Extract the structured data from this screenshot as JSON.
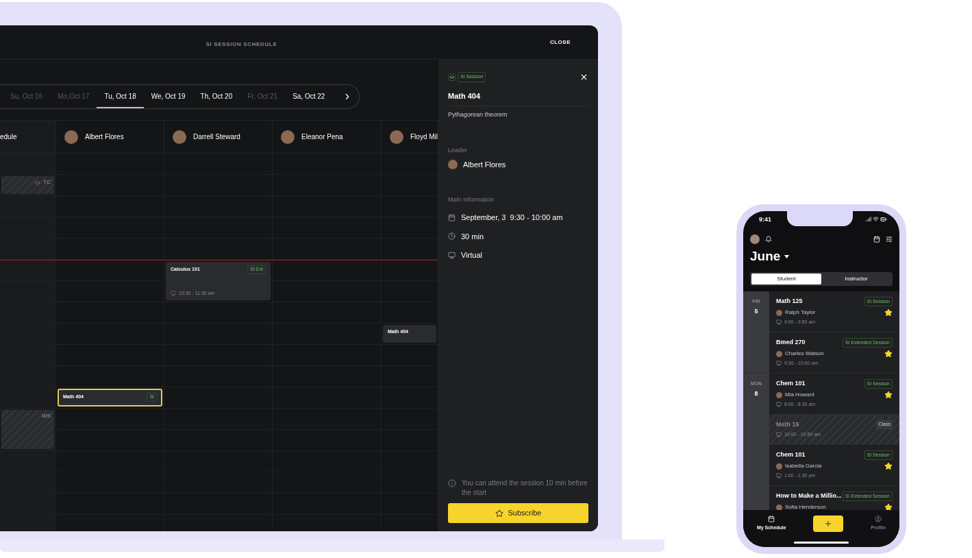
{
  "laptop": {
    "header": {
      "title": "SI SESSION SCHEDULE",
      "close": "CLOSE"
    },
    "dates": [
      {
        "label": "Su, Oct 16",
        "selected": false,
        "disabled": true
      },
      {
        "label": "Mo,Oct 17",
        "selected": false,
        "disabled": true
      },
      {
        "label": "Tu, Oct 18",
        "selected": true,
        "disabled": false
      },
      {
        "label": "We, Oct 19",
        "selected": false,
        "disabled": false
      },
      {
        "label": "Th, Oct 20",
        "selected": false,
        "disabled": false
      },
      {
        "label": "Fr, Oct 21",
        "selected": false,
        "disabled": true
      },
      {
        "label": "Sa, Oct 22",
        "selected": false,
        "disabled": false
      }
    ],
    "columns": [
      {
        "kind": "label",
        "name": "edule"
      },
      {
        "kind": "person",
        "name": "Albert Flores"
      },
      {
        "kind": "person",
        "name": "Darrell Steward"
      },
      {
        "kind": "person",
        "name": "Eleanor Pena"
      },
      {
        "kind": "person",
        "name": "Floyd Mil"
      }
    ],
    "rows": [
      {
        "now": false,
        "cells": [
          {
            "kind": "empty"
          },
          {
            "kind": "empty"
          },
          {
            "kind": "empty"
          },
          {
            "kind": "empty"
          },
          {
            "kind": "empty"
          }
        ]
      },
      {
        "now": false,
        "cells": [
          {
            "kind": "blocked",
            "code": "TC",
            "has_icon": true
          },
          {
            "kind": "empty"
          },
          {
            "kind": "empty"
          },
          {
            "kind": "empty"
          },
          {
            "kind": "empty"
          }
        ]
      },
      {
        "now": false,
        "cells": [
          {
            "kind": "empty"
          },
          {
            "kind": "empty"
          },
          {
            "kind": "empty"
          },
          {
            "kind": "empty"
          },
          {
            "kind": "empty"
          }
        ]
      },
      {
        "now": false,
        "cells": [
          {
            "kind": "empty"
          },
          {
            "kind": "empty"
          },
          {
            "kind": "empty"
          },
          {
            "kind": "empty"
          },
          {
            "kind": "empty"
          }
        ]
      },
      {
        "now": false,
        "cells": [
          {
            "kind": "empty"
          },
          {
            "kind": "empty"
          },
          {
            "kind": "empty"
          },
          {
            "kind": "empty"
          },
          {
            "kind": "empty"
          }
        ]
      },
      {
        "now": true,
        "cells": [
          {
            "kind": "empty"
          },
          {
            "kind": "empty"
          },
          {
            "kind": "session",
            "title": "Calculus 101",
            "badge": "SI Ext",
            "time": "10:30 - 11:30 am",
            "selected": false
          },
          {
            "kind": "empty"
          },
          {
            "kind": "empty"
          }
        ]
      },
      {
        "now": false,
        "cells": [
          {
            "kind": "empty"
          },
          {
            "kind": "empty"
          },
          {
            "kind": "continued"
          },
          {
            "kind": "empty"
          },
          {
            "kind": "empty"
          }
        ]
      },
      {
        "now": false,
        "cells": [
          {
            "kind": "empty"
          },
          {
            "kind": "empty"
          },
          {
            "kind": "empty"
          },
          {
            "kind": "empty"
          },
          {
            "kind": "empty"
          }
        ]
      },
      {
        "now": false,
        "cells": [
          {
            "kind": "empty"
          },
          {
            "kind": "empty"
          },
          {
            "kind": "empty"
          },
          {
            "kind": "empty"
          },
          {
            "kind": "session",
            "title": "Math 404",
            "selected": false
          }
        ]
      },
      {
        "now": false,
        "cells": [
          {
            "kind": "empty"
          },
          {
            "kind": "empty"
          },
          {
            "kind": "empty"
          },
          {
            "kind": "empty"
          },
          {
            "kind": "empty"
          }
        ]
      },
      {
        "now": false,
        "cells": [
          {
            "kind": "empty"
          },
          {
            "kind": "empty"
          },
          {
            "kind": "empty"
          },
          {
            "kind": "empty"
          },
          {
            "kind": "empty"
          }
        ]
      },
      {
        "now": false,
        "cells": [
          {
            "kind": "empty"
          },
          {
            "kind": "session",
            "title": "Math 404",
            "badge": "SI",
            "selected": true
          },
          {
            "kind": "empty"
          },
          {
            "kind": "empty"
          },
          {
            "kind": "empty"
          }
        ]
      },
      {
        "now": false,
        "cells": [
          {
            "kind": "blocked",
            "code": "WS",
            "has_icon": false
          },
          {
            "kind": "empty"
          },
          {
            "kind": "empty"
          },
          {
            "kind": "empty"
          },
          {
            "kind": "empty"
          }
        ]
      },
      {
        "now": false,
        "cells": [
          {
            "kind": "continued"
          },
          {
            "kind": "empty"
          },
          {
            "kind": "empty"
          },
          {
            "kind": "empty"
          },
          {
            "kind": "empty"
          }
        ]
      },
      {
        "now": false,
        "cells": [
          {
            "kind": "empty"
          },
          {
            "kind": "empty"
          },
          {
            "kind": "empty"
          },
          {
            "kind": "empty"
          },
          {
            "kind": "empty"
          }
        ]
      },
      {
        "now": false,
        "cells": [
          {
            "kind": "empty"
          },
          {
            "kind": "empty"
          },
          {
            "kind": "empty"
          },
          {
            "kind": "empty"
          },
          {
            "kind": "empty"
          }
        ]
      },
      {
        "now": false,
        "cells": [
          {
            "kind": "empty"
          },
          {
            "kind": "empty"
          },
          {
            "kind": "empty"
          },
          {
            "kind": "empty"
          },
          {
            "kind": "empty"
          }
        ]
      },
      {
        "now": false,
        "cells": [
          {
            "kind": "empty"
          },
          {
            "kind": "empty"
          },
          {
            "kind": "empty"
          },
          {
            "kind": "empty"
          },
          {
            "kind": "empty"
          }
        ]
      }
    ],
    "detail": {
      "badge": "SI Session",
      "title": "Math 404",
      "topic": "Pythagorean theorem",
      "leader_label": "Leader",
      "leader": "Albert Flores",
      "info_label": "Main Information",
      "info": [
        {
          "kind": "date",
          "text": "September, 3  9:30 - 10:00 am"
        },
        {
          "kind": "duration",
          "text": "30 min"
        },
        {
          "kind": "place",
          "text": "Virtual"
        }
      ],
      "note": "You can attend the session 10 min before the start",
      "button": "Subscribe"
    }
  },
  "phone": {
    "status_time": "9:41",
    "month": "June",
    "segments": [
      {
        "label": "Student",
        "selected": true
      },
      {
        "label": "Instructor",
        "selected": false
      }
    ],
    "days": [
      {
        "weekday": "FRI",
        "day": "5",
        "items": [
          {
            "kind": "session",
            "title": "Math 125",
            "badge": "SI Session",
            "person": "Ralph Taylor",
            "time": "9:00 - 9:50 am",
            "starred": true
          },
          {
            "kind": "session",
            "title": "Bmed 270",
            "badge": "SI Extended Session",
            "person": "Charles Watson",
            "time": "9:30 - 10:00 am",
            "starred": true
          }
        ]
      },
      {
        "weekday": "MON",
        "day": "8",
        "items": [
          {
            "kind": "session",
            "title": "Chem 101",
            "badge": "SI Session",
            "person": "Mia Howard",
            "time": "8:00 - 8:30 am",
            "starred": true
          },
          {
            "kind": "class",
            "title": "Math 15",
            "badge": "Class",
            "time": "10:00 - 10:50 am"
          },
          {
            "kind": "session",
            "title": "Chem 101",
            "badge": "SI Session",
            "person": "Isabella Garcia",
            "time": "1:00 - 1:30 pm",
            "starred": true
          },
          {
            "kind": "session",
            "title": "How to Make a Millio...",
            "badge": "SI Extended Session",
            "person": "Sofia Henderson",
            "starred": true
          }
        ]
      }
    ],
    "tabs": [
      {
        "kind": "schedule",
        "label": "My Schedule",
        "selected": true
      },
      {
        "kind": "add"
      },
      {
        "kind": "profile",
        "label": "Profile",
        "selected": false
      }
    ]
  }
}
